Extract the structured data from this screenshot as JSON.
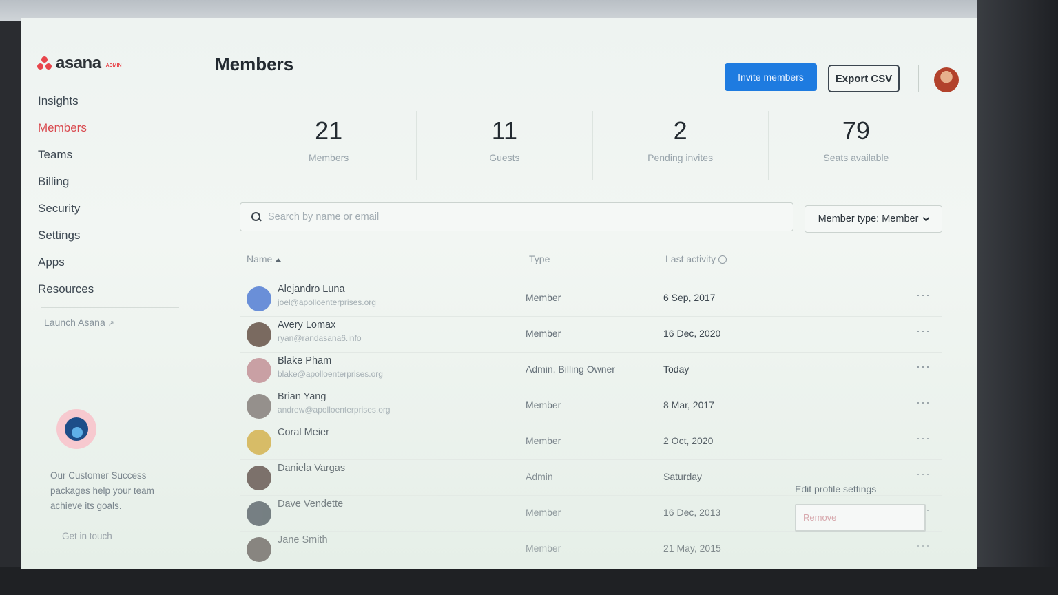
{
  "app": {
    "logo_text": "asana",
    "logo_badge": "ADMIN"
  },
  "sidebar": {
    "items": [
      {
        "label": "Insights",
        "active": false
      },
      {
        "label": "Members",
        "active": true
      },
      {
        "label": "Teams",
        "active": false
      },
      {
        "label": "Billing",
        "active": false
      },
      {
        "label": "Security",
        "active": false
      },
      {
        "label": "Settings",
        "active": false
      },
      {
        "label": "Apps",
        "active": false
      },
      {
        "label": "Resources",
        "active": false
      }
    ],
    "launch_label": "Launch Asana",
    "promo_text": "Our Customer Success packages help your team achieve its goals.",
    "promo_link": "Get in touch"
  },
  "header": {
    "title": "Members",
    "invite_label": "Invite members",
    "export_label": "Export CSV"
  },
  "stats": [
    {
      "value": "21",
      "label": "Members"
    },
    {
      "value": "11",
      "label": "Guests"
    },
    {
      "value": "2",
      "label": "Pending invites"
    },
    {
      "value": "79",
      "label": "Seats available"
    }
  ],
  "search": {
    "placeholder": "Search by name or email",
    "value": ""
  },
  "filter": {
    "label": "Member type: Member"
  },
  "table": {
    "headers": {
      "name": "Name",
      "type": "Type",
      "activity": "Last activity"
    },
    "rows": [
      {
        "name": "Alejandro Luna",
        "email": "joel@apolloenterprises.org",
        "type": "Member",
        "activity": "6 Sep, 2017",
        "avatar_color": "#6a8fd8"
      },
      {
        "name": "Avery Lomax",
        "email": "ryan@randasana6.info",
        "type": "Member",
        "activity": "16 Dec, 2020",
        "avatar_color": "#7a6a60"
      },
      {
        "name": "Blake Pham",
        "email": "blake@apolloenterprises.org",
        "type": "Admin, Billing Owner",
        "activity": "Today",
        "avatar_color": "#c9a0a4"
      },
      {
        "name": "Brian Yang",
        "email": "andrew@apolloenterprises.org",
        "type": "Member",
        "activity": "8 Mar, 2017",
        "avatar_color": "#8e8884"
      },
      {
        "name": "Coral Meier",
        "email": "",
        "type": "Member",
        "activity": "2 Oct, 2020",
        "avatar_color": "#d4b24e"
      },
      {
        "name": "Daniela Vargas",
        "email": "",
        "type": "Admin",
        "activity": "Saturday",
        "avatar_color": "#5b4a44"
      },
      {
        "name": "Dave Vendette",
        "email": "",
        "type": "Member",
        "activity": "16 Dec, 2013",
        "avatar_color": "#3f4a52"
      },
      {
        "name": "Jane Smith",
        "email": "",
        "type": "Member",
        "activity": "21 May, 2015",
        "avatar_color": "#4a3f3c"
      }
    ],
    "more_label": "···"
  },
  "row_menu": {
    "edit_label": "Edit profile settings",
    "remove_label": "Remove"
  }
}
